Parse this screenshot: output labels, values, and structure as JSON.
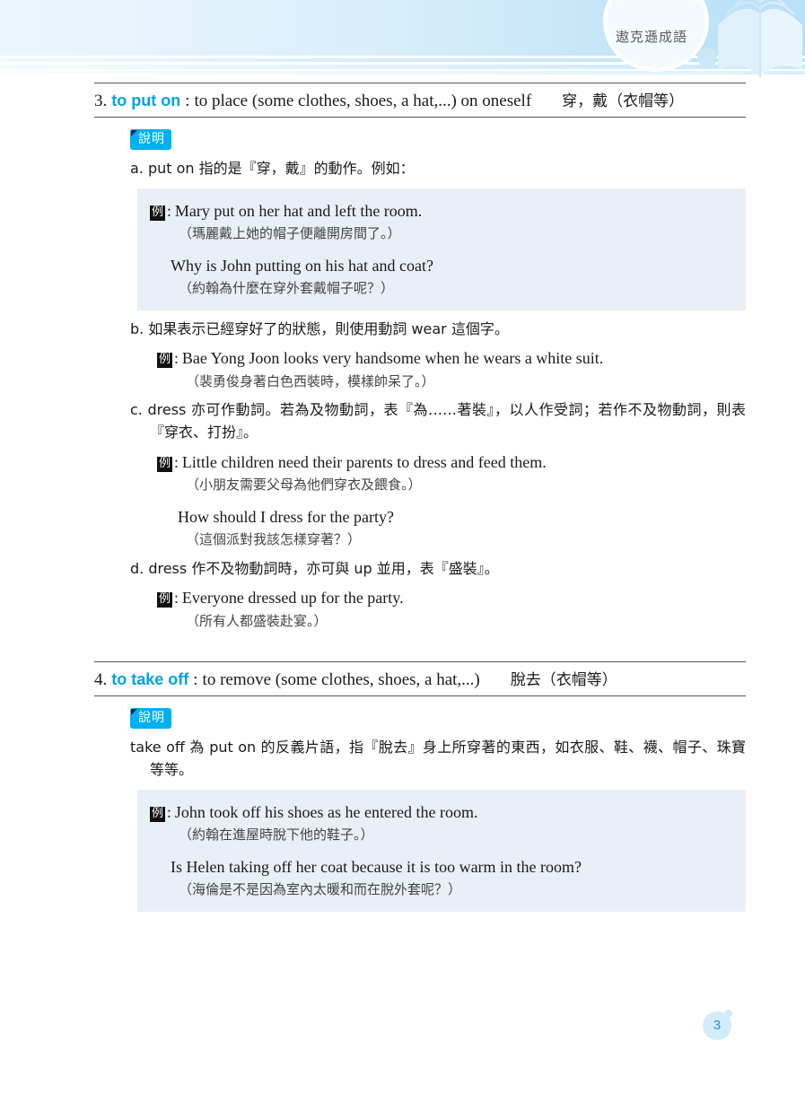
{
  "header": {
    "title": "遨克遜成語",
    "book_icon": "open-book-icon"
  },
  "footer": {
    "page_number": "3"
  },
  "colors": {
    "accent_blue": "#00a2e8",
    "badge_cyan": "#00b0f0",
    "example_box_bg": "#e9eff7",
    "page_badge_bg": "#d3ecf9",
    "page_number_text": "#2196d8"
  },
  "entries": [
    {
      "number": "3.",
      "phrase": "to put on",
      "colon": ":",
      "definition": "to place (some clothes, shoes, a hat,...) on oneself",
      "chinese": "穿，戴（衣帽等）",
      "note_label": "說明",
      "blocks": [
        {
          "type": "paragraph",
          "text": "a. put on 指的是『穿，戴』的動作。例如："
        },
        {
          "type": "example-box",
          "shaded": true,
          "groups": [
            {
              "tag": "例",
              "colon": ":",
              "english": "Mary put on her hat and left the room.",
              "translation": "（瑪麗戴上她的帽子便離開房間了。）"
            },
            {
              "tag": "",
              "colon": "",
              "english": "Why is John putting on his hat and coat?",
              "translation": "（約翰為什麼在穿外套戴帽子呢？）"
            }
          ]
        },
        {
          "type": "paragraph",
          "text": "b. 如果表示已經穿好了的狀態，則使用動詞 wear 這個字。"
        },
        {
          "type": "example-box",
          "shaded": false,
          "groups": [
            {
              "tag": "例",
              "colon": ":",
              "english": "Bae Yong Joon looks very handsome when he wears a white suit.",
              "translation": "（裴勇俊身著白色西裝時，模樣帥呆了。）"
            }
          ]
        },
        {
          "type": "paragraph",
          "text": "c. dress 亦可作動詞。若為及物動詞，表『為……著裝』，以人作受詞；若作不及物動詞，則表『穿衣、打扮』。"
        },
        {
          "type": "example-box",
          "shaded": false,
          "groups": [
            {
              "tag": "例",
              "colon": ":",
              "english": "Little children need their parents to dress and feed them.",
              "translation": "（小朋友需要父母為他們穿衣及餵食。）"
            },
            {
              "tag": "",
              "colon": "",
              "english": "How should I dress for the party?",
              "translation": "（這個派對我該怎樣穿著？）"
            }
          ]
        },
        {
          "type": "paragraph",
          "text": "d. dress 作不及物動詞時，亦可與 up 並用，表『盛裝』。"
        },
        {
          "type": "example-box",
          "shaded": false,
          "groups": [
            {
              "tag": "例",
              "colon": ":",
              "english": "Everyone dressed up for the party.",
              "translation": "（所有人都盛裝赴宴。）"
            }
          ]
        }
      ]
    },
    {
      "number": "4.",
      "phrase": "to take off",
      "colon": ":",
      "definition": "to remove (some clothes, shoes, a hat,...)",
      "chinese": "脫去（衣帽等）",
      "note_label": "說明",
      "blocks": [
        {
          "type": "paragraph",
          "text": "take off 為 put on 的反義片語，指『脫去』身上所穿著的東西，如衣服、鞋、襪、帽子、珠寶等等。"
        },
        {
          "type": "example-box",
          "shaded": true,
          "groups": [
            {
              "tag": "例",
              "colon": ":",
              "english": "John took off his shoes as he entered the room.",
              "translation": "（約翰在進屋時脫下他的鞋子。）"
            },
            {
              "tag": "",
              "colon": "",
              "english": "Is Helen taking off her coat because it is too warm in the room?",
              "translation": "（海倫是不是因為室內太暖和而在脫外套呢？）"
            }
          ]
        }
      ]
    }
  ]
}
